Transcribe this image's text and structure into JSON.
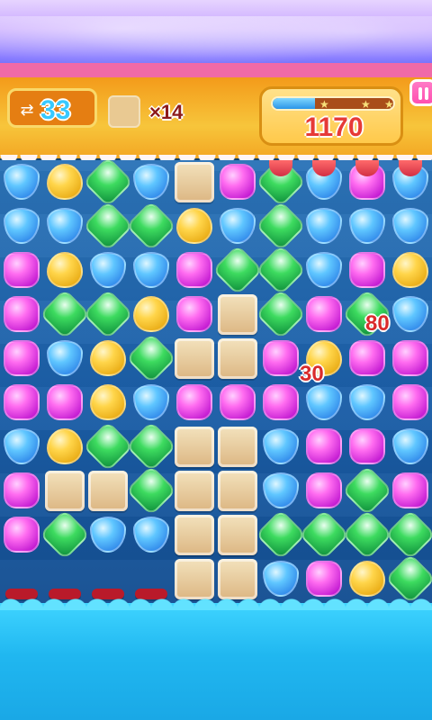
{
  "hud": {
    "moves_left": "33",
    "goal_count": "×14",
    "score": "1170",
    "progress_fraction": 0.35
  },
  "popups": [
    {
      "text": "80"
    },
    {
      "text": "30"
    }
  ],
  "board": {
    "rows": [
      [
        "blue",
        "yellow",
        "green",
        "blue",
        "block",
        "purple",
        "green",
        "blue",
        "purple",
        "blue"
      ],
      [
        "blue",
        "blue",
        "green",
        "green",
        "yellow",
        "blue",
        "green",
        "blue",
        "blue",
        "blue"
      ],
      [
        "purple",
        "yellow",
        "blue",
        "blue",
        "purple",
        "green",
        "green",
        "blue",
        "purple",
        "yellow"
      ],
      [
        "purple",
        "green",
        "green",
        "yellow",
        "purple",
        "block",
        "green",
        "purple",
        "green",
        "blue"
      ],
      [
        "purple",
        "blue",
        "yellow",
        "green",
        "block",
        "block",
        "purple",
        "yellow",
        "purple",
        "purple"
      ],
      [
        "purple",
        "purple",
        "yellow",
        "blue",
        "purple",
        "purple",
        "purple",
        "blue",
        "blue",
        "purple"
      ],
      [
        "blue",
        "yellow",
        "green",
        "green",
        "block",
        "block",
        "blue",
        "purple",
        "purple",
        "blue"
      ],
      [
        "purple",
        "block",
        "block",
        "green",
        "block",
        "block",
        "blue",
        "purple",
        "green",
        "purple"
      ],
      [
        "purple",
        "green",
        "blue",
        "blue",
        "block",
        "block",
        "green",
        "green",
        "green",
        "green"
      ],
      [
        "",
        "",
        "",
        "",
        "block",
        "block",
        "blue",
        "purple",
        "yellow",
        "green"
      ]
    ]
  }
}
